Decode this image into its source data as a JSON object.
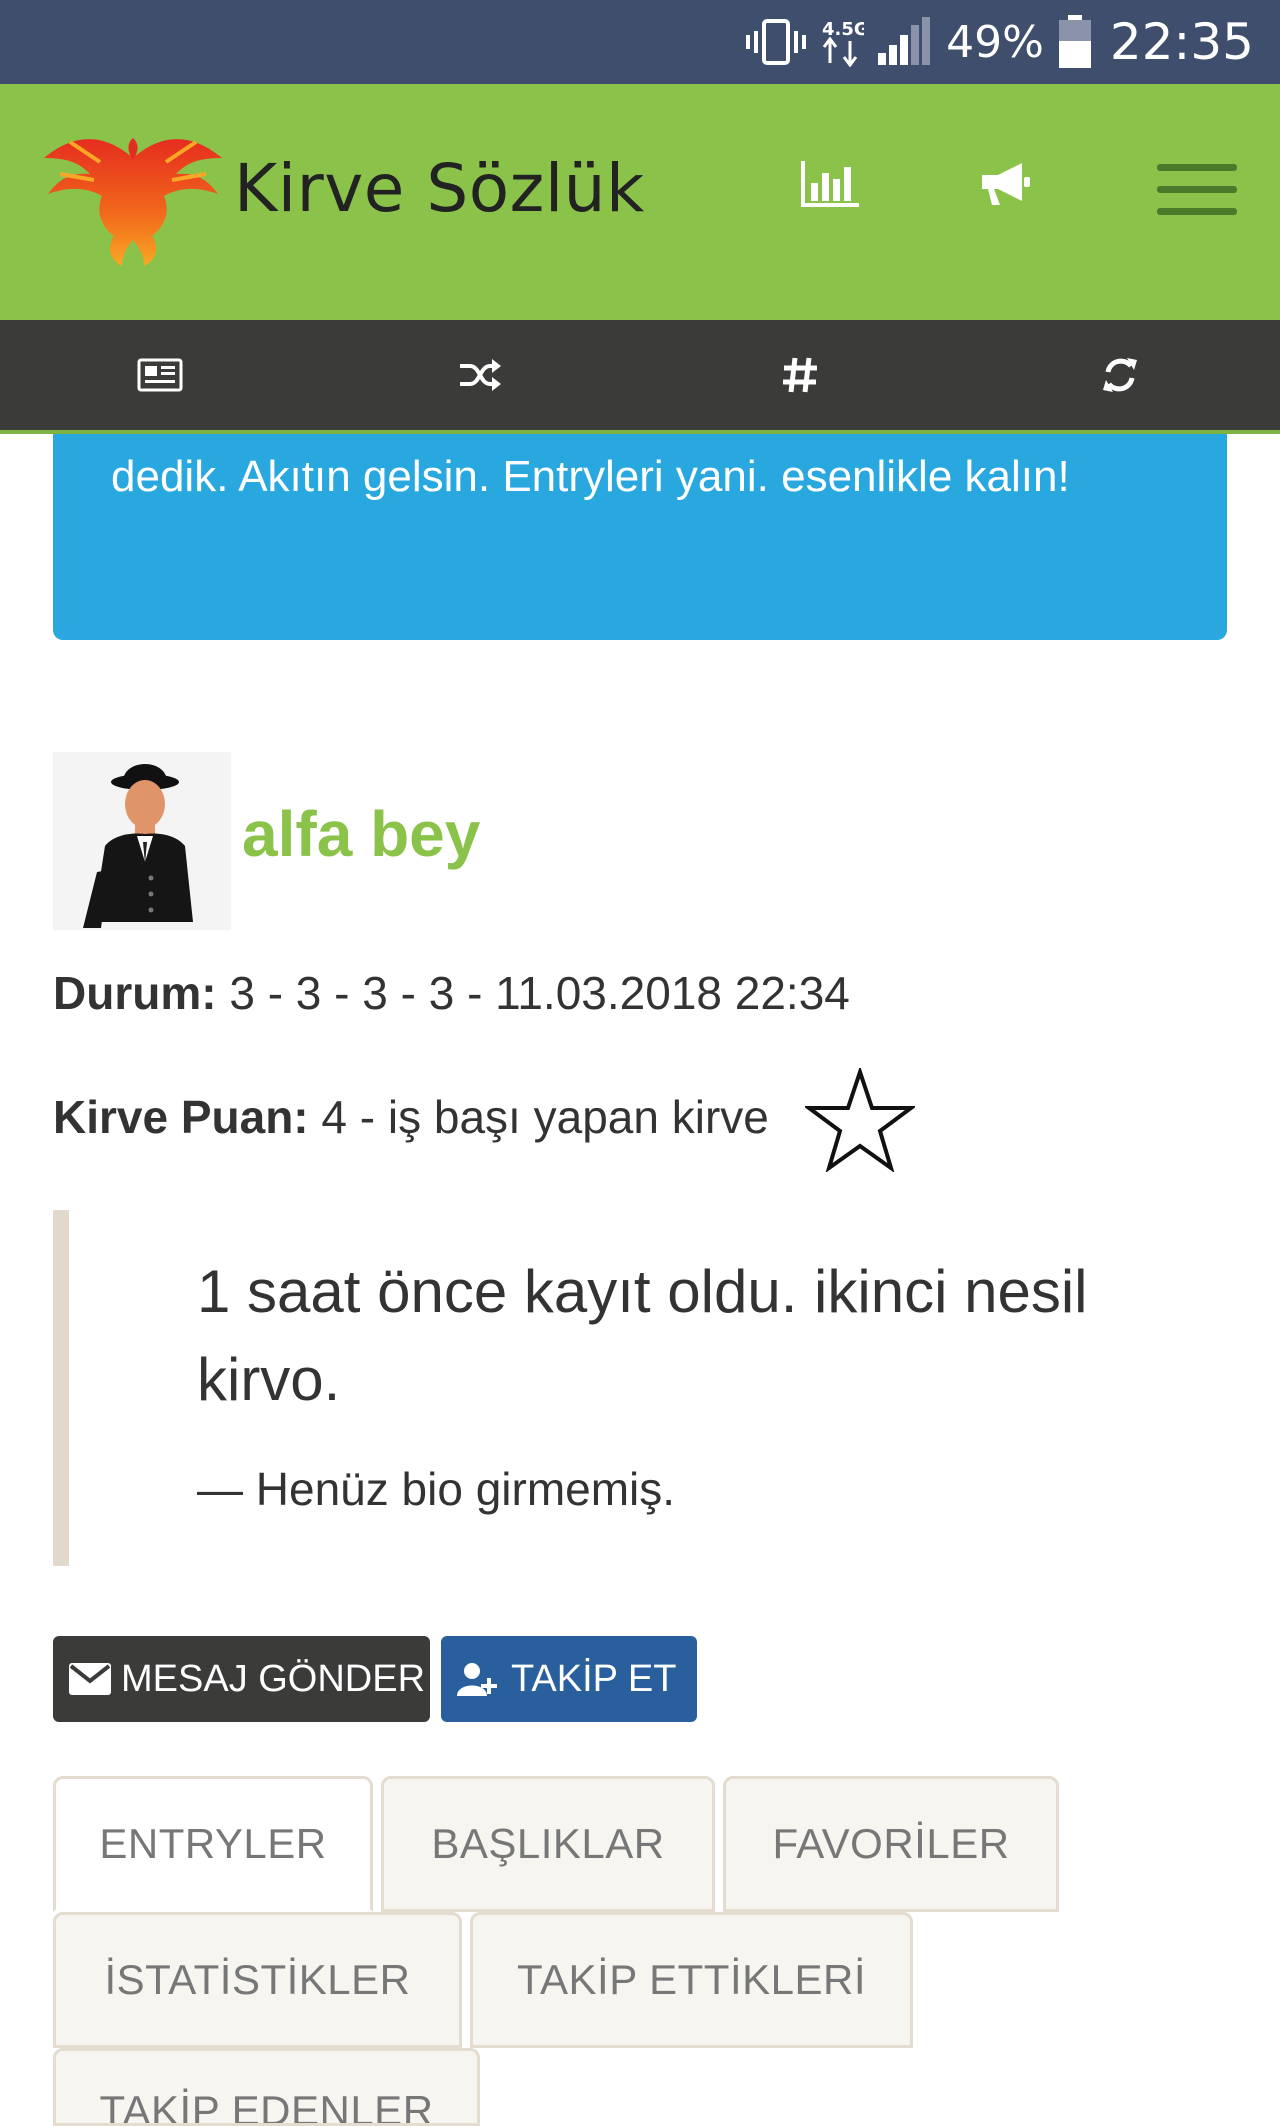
{
  "status_bar": {
    "network": "4.5G",
    "battery": "49%",
    "time": "22:35"
  },
  "header": {
    "brand": "Kirve Sözlük"
  },
  "alert": {
    "text": "dedik. Akıtın gelsin. Entryleri yani. esenlikle kalın!"
  },
  "profile": {
    "username": "alfa bey",
    "status_label": "Durum:",
    "status_value": "3 - 3 - 3 - 3 - 11.03.2018 22:34",
    "score_label": "Kirve Puan:",
    "score_value": "4 - iş başı yapan kirve"
  },
  "bio": {
    "text": "1 saat önce kayıt oldu. ikinci nesil kirvo.",
    "footer": "— Henüz bio girmemiş."
  },
  "actions": {
    "message": "MESAJ GÖNDER",
    "follow": "TAKİP ET"
  },
  "tabs": [
    "ENTRYLER",
    "BAŞLIKLAR",
    "FAVORİLER",
    "İSTATİSTİKLER",
    "TAKİP ETTİKLERİ",
    "TAKİP EDENLER"
  ],
  "colors": {
    "status_bar": "#3f4e6d",
    "header": "#8bc34a",
    "toolbar": "#3b3c3a",
    "alert": "#29a8e0",
    "username": "#8bc34a",
    "follow_button": "#2a5f9e"
  },
  "icons": {
    "header": [
      "stats-chart-icon",
      "megaphone-icon",
      "hamburger-menu-icon"
    ],
    "toolbar": [
      "newspaper-icon",
      "shuffle-icon",
      "hashtag-icon",
      "refresh-icon"
    ]
  }
}
